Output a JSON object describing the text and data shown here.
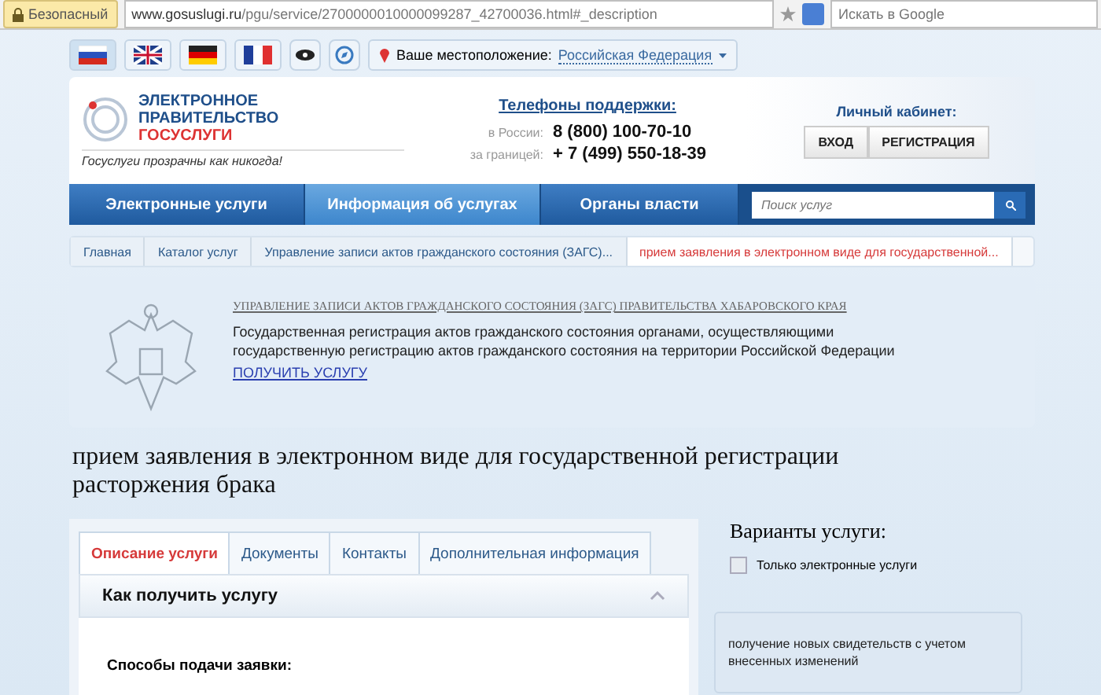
{
  "browser": {
    "security_badge": "Безопасный",
    "url_host": "www.gosuslugi.ru",
    "url_path": "/pgu/service/2700000010000099287_42700036.html#_description",
    "search_placeholder": "Искать в Google"
  },
  "languages": [
    {
      "kind": "ru",
      "selected": true
    },
    {
      "kind": "gb",
      "selected": false
    },
    {
      "kind": "de",
      "selected": false
    },
    {
      "kind": "fr",
      "selected": false
    }
  ],
  "location": {
    "label": "Ваше местоположение:",
    "value": "Российская Федерация"
  },
  "logo": {
    "lines": [
      "ЭЛЕКТРОННОЕ",
      "ПРАВИТЕЛЬСТВО"
    ],
    "accent": "ГОСУСЛУГИ",
    "slogan": "Госуслуги прозрачны как никогда!"
  },
  "support": {
    "title": "Телефоны поддержки:",
    "phones": [
      {
        "label": "в России:",
        "number": "8 (800) 100-70-10"
      },
      {
        "label": "за границей:",
        "number": "+ 7 (499) 550-18-39"
      }
    ]
  },
  "cabinet": {
    "title": "Личный кабинет:",
    "buttons": [
      "ВХОД",
      "РЕГИСТРАЦИЯ"
    ]
  },
  "nav": [
    {
      "label": "Электронные услуги",
      "selected": false
    },
    {
      "label": "Информация об услугах",
      "selected": true
    },
    {
      "label": "Органы власти",
      "selected": false
    }
  ],
  "nav_search": {
    "placeholder": "Поиск услуг"
  },
  "breadcrumbs": [
    {
      "label": "Главная",
      "current": false
    },
    {
      "label": "Каталог услуг",
      "current": false
    },
    {
      "label": "Управление записи актов гражданского состояния (ЗАГС)...",
      "current": false
    },
    {
      "label": "прием заявления в электронном виде для государственной...",
      "current": true
    }
  ],
  "agency": {
    "name": "УПРАВЛЕНИЕ ЗАПИСИ АКТОВ ГРАЖДАНСКОГО СОСТОЯНИЯ (ЗАГС) ПРАВИТЕЛЬСТВА ХАБАРОВСКОГО КРАЯ",
    "description": "Государственная регистрация актов гражданского состояния органами, осуществляющими государственную регистрацию актов гражданского состояния на территории Российской Федерации",
    "link": "ПОЛУЧИТЬ УСЛУГУ"
  },
  "title": "прием заявления в электронном виде для государственной регистрации расторжения брака",
  "tabs": [
    {
      "label": "Описание услуги",
      "selected": true
    },
    {
      "label": "Документы",
      "selected": false
    },
    {
      "label": "Контакты",
      "selected": false
    },
    {
      "label": "Дополнительная информация",
      "selected": false
    }
  ],
  "section": {
    "title": "Как получить услугу",
    "expanded": true,
    "subtitle": "Способы подачи заявки:"
  },
  "variants": {
    "title": "Варианты услуги:",
    "filter": {
      "label": "Только электронные услуги",
      "checked": false
    },
    "items": [
      "получение новых свидетельств с учетом внесенных изменений"
    ]
  }
}
